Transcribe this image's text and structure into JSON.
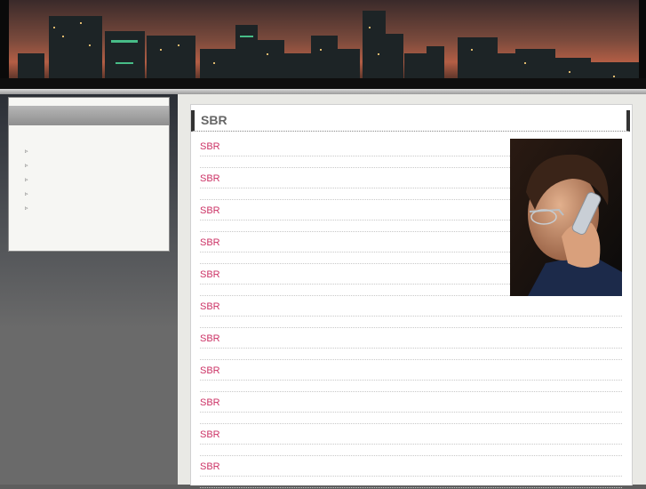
{
  "main": {
    "title": "SBR",
    "links": [
      "SBR",
      "SBR",
      "SBR",
      "SBR",
      "SBR",
      "SBR",
      "SBR",
      "SBR",
      "SBR",
      "SBR",
      "SBR"
    ]
  },
  "sidebar": {
    "items": [
      {
        "bullet": "▹"
      },
      {
        "bullet": "▹"
      },
      {
        "bullet": "▹"
      },
      {
        "bullet": "▹"
      },
      {
        "bullet": "▹"
      }
    ]
  },
  "colors": {
    "link": "#cc3366",
    "title": "#666666",
    "background": "#5e5e5e"
  }
}
